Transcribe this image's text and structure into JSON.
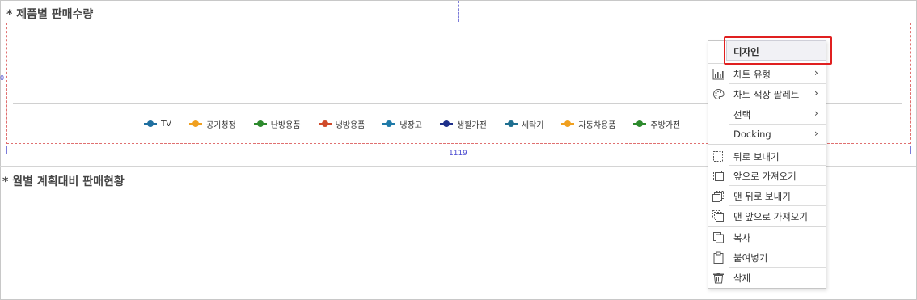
{
  "sections": {
    "title1": "* 제품별 판매수량",
    "title2": "* 월별 계획대비 판매현황"
  },
  "chart_data": {
    "type": "line",
    "title": "",
    "xlabel": "",
    "ylabel": "",
    "series": [
      {
        "name": "TV",
        "color": "#1f6fa0"
      },
      {
        "name": "공기청정",
        "color": "#f0a020"
      },
      {
        "name": "난방용품",
        "color": "#2d8a2d"
      },
      {
        "name": "냉방용품",
        "color": "#d04a2a"
      },
      {
        "name": "냉장고",
        "color": "#1f7aa8"
      },
      {
        "name": "생활가전",
        "color": "#1e2f8a"
      },
      {
        "name": "세탁기",
        "color": "#1f6f90"
      },
      {
        "name": "자동차용품",
        "color": "#f0a020"
      },
      {
        "name": "주방가전",
        "color": "#2d8a2d"
      }
    ]
  },
  "guides": {
    "width_label": "1119",
    "side_label": "0"
  },
  "context_menu": {
    "items": [
      {
        "label": "디자인",
        "icon": "none",
        "submenu": false,
        "highlighted": true
      },
      {
        "label": "차트 유형",
        "icon": "bar-chart-icon",
        "submenu": true
      },
      {
        "label": "차트 색상 팔레트",
        "icon": "palette-icon",
        "submenu": true
      },
      {
        "label": "선택",
        "icon": "none",
        "submenu": true
      },
      {
        "label": "Docking",
        "icon": "none",
        "submenu": true
      },
      {
        "label": "뒤로 보내기",
        "icon": "send-backward-icon",
        "submenu": false
      },
      {
        "label": "앞으로 가져오기",
        "icon": "bring-forward-icon",
        "submenu": false
      },
      {
        "label": "맨 뒤로 보내기",
        "icon": "send-to-back-icon",
        "submenu": false
      },
      {
        "label": "맨 앞으로 가져오기",
        "icon": "bring-to-front-icon",
        "submenu": false
      },
      {
        "label": "복사",
        "icon": "copy-icon",
        "submenu": false
      },
      {
        "label": "붙여넣기",
        "icon": "paste-icon",
        "submenu": false
      },
      {
        "label": "삭제",
        "icon": "trash-icon",
        "submenu": false
      }
    ],
    "arrow_glyph": "›"
  },
  "colors": {
    "highlight_border": "#e02020",
    "widget_border": "#e07070",
    "guide": "#7b7bd9"
  }
}
